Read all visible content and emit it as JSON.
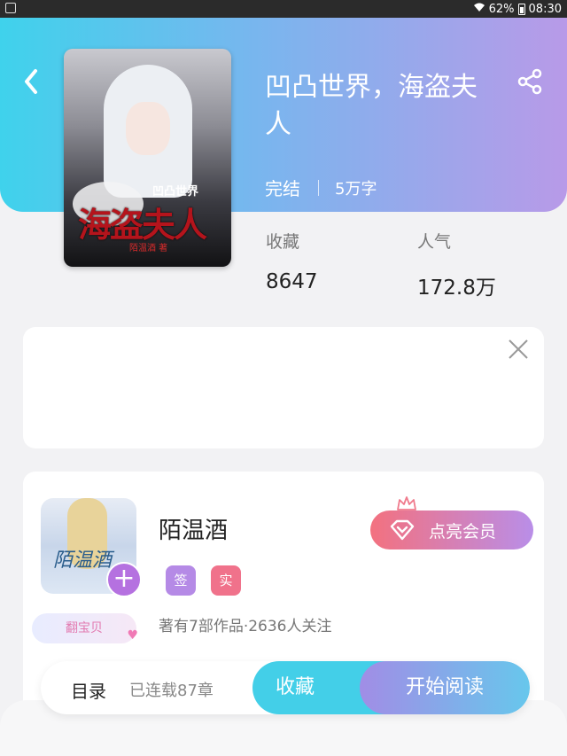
{
  "status_bar": {
    "battery": "62%",
    "time": "08:30"
  },
  "book": {
    "title": "凹凸世界，海盗夫人",
    "status": "完结",
    "word_count": "5万字",
    "cover": {
      "top_text": "凹凸世界",
      "main_text": "海盗夫人",
      "author_text": "陌温酒 著"
    }
  },
  "stats": [
    {
      "label": "收藏",
      "value": "8647"
    },
    {
      "label": "人气",
      "value": "172.8万"
    }
  ],
  "author": {
    "name": "陌温酒",
    "avatar_text": "陌温酒",
    "tags": [
      "签",
      "实"
    ],
    "summary": "著有7部作品·2636人关注",
    "fan_badge": "翻宝贝",
    "vip_button": "点亮会员"
  },
  "bottom_bar": {
    "toc_label": "目录",
    "chapter_status": "已连载87章",
    "collect_label": "收藏",
    "read_label": "开始阅读"
  },
  "colors": {
    "gradient_start": "#3fd2ec",
    "gradient_end": "#b89ae8",
    "collect": "#43cfe8"
  }
}
